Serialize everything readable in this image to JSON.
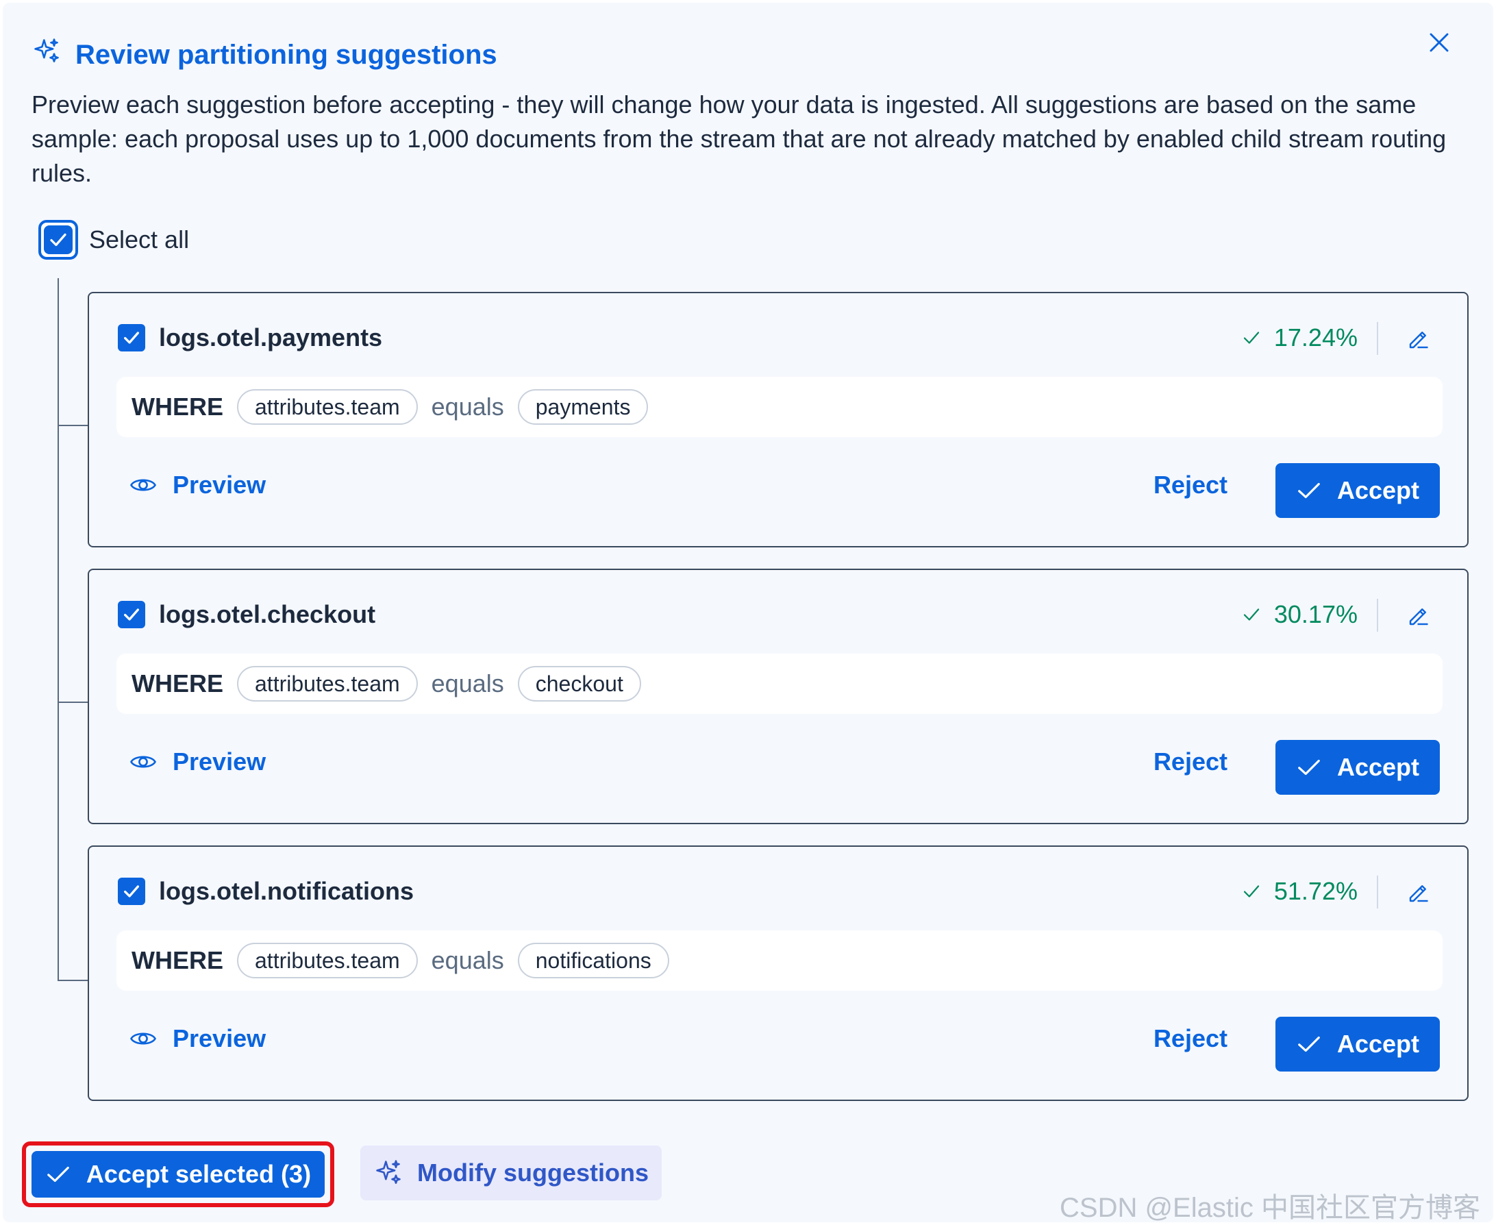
{
  "dialog": {
    "title": "Review partitioning suggestions",
    "description": "Preview each suggestion before accepting - they will change how your data is ingested. All suggestions are based on the same sample: each proposal uses up to 1,000 documents from the stream that are not already matched by enabled child stream routing rules.",
    "close_icon": "close-icon",
    "title_icon": "sparkles-icon"
  },
  "select_all": {
    "label": "Select all",
    "checked": true
  },
  "suggestions": [
    {
      "name": "logs.otel.payments",
      "checked": true,
      "percent": "17.24%",
      "where_keyword": "WHERE",
      "field": "attributes.team",
      "operator": "equals",
      "value": "payments",
      "preview_label": "Preview",
      "reject_label": "Reject",
      "accept_label": "Accept"
    },
    {
      "name": "logs.otel.checkout",
      "checked": true,
      "percent": "30.17%",
      "where_keyword": "WHERE",
      "field": "attributes.team",
      "operator": "equals",
      "value": "checkout",
      "preview_label": "Preview",
      "reject_label": "Reject",
      "accept_label": "Accept"
    },
    {
      "name": "logs.otel.notifications",
      "checked": true,
      "percent": "51.72%",
      "where_keyword": "WHERE",
      "field": "attributes.team",
      "operator": "equals",
      "value": "notifications",
      "preview_label": "Preview",
      "reject_label": "Reject",
      "accept_label": "Accept"
    }
  ],
  "footer": {
    "accept_selected_label": "Accept selected (3)",
    "modify_label": "Modify suggestions"
  },
  "watermark": "CSDN @Elastic 中国社区官方博客",
  "colors": {
    "primary": "#0b64dd",
    "success": "#008a5e",
    "highlight": "#e6121b",
    "panel_bg": "#f5f8fd"
  }
}
